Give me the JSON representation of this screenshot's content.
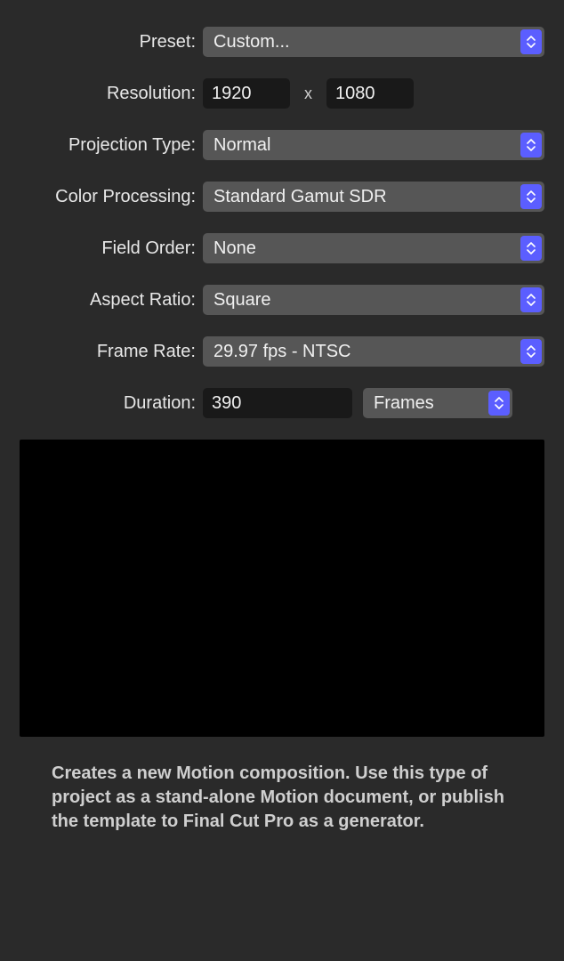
{
  "labels": {
    "preset": "Preset:",
    "resolution": "Resolution:",
    "projection": "Projection Type:",
    "color": "Color Processing:",
    "field": "Field Order:",
    "aspect": "Aspect Ratio:",
    "framerate": "Frame Rate:",
    "duration": "Duration:"
  },
  "values": {
    "preset": "Custom...",
    "res_w": "1920",
    "res_h": "1080",
    "res_sep": "x",
    "projection": "Normal",
    "color": "Standard Gamut SDR",
    "field": "None",
    "aspect": "Square",
    "framerate": "29.97 fps - NTSC",
    "duration": "390",
    "duration_unit": "Frames"
  },
  "description": "Creates a new Motion composition. Use this type of project as a stand-alone Motion document, or publish the template to Final Cut Pro as a generator."
}
